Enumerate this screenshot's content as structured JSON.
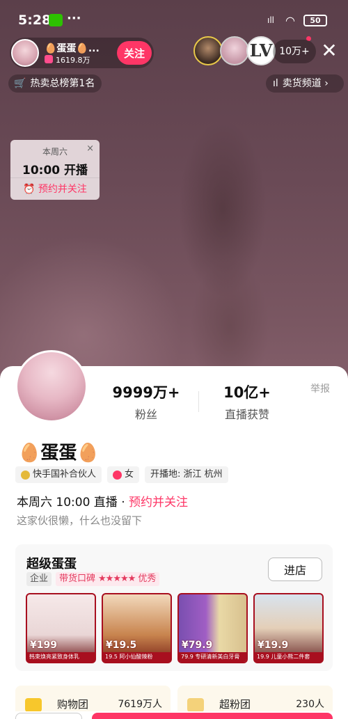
{
  "status_bar": {
    "time": "5:28",
    "dots": "···",
    "signal": "ıll",
    "battery": "50"
  },
  "streamer": {
    "name": "🥚蛋蛋🥚...",
    "likes": "1619.8万",
    "follow_label": "关注"
  },
  "viewers": {
    "count": "10万+",
    "v3_logo": "LV"
  },
  "close_glyph": "✕",
  "rank": {
    "icon": "🛒",
    "label": "热卖总榜第1名"
  },
  "channel": {
    "label": "卖货频道 ›"
  },
  "schedule_popup": {
    "day": "本周六",
    "time": "10:00 开播",
    "remind_label": "⏰ 预约并关注",
    "close": "×"
  },
  "profile": {
    "fans_value": "9999万+",
    "fans_label": "粉丝",
    "likes_value": "10亿+",
    "likes_label": "直播获赞",
    "report": "举报",
    "name": "🥚蛋蛋🥚",
    "tags": [
      "快手国补合伙人",
      "女",
      "开播地: 浙江 杭州"
    ],
    "schedule_text": "本周六 10:00 直播 · ",
    "schedule_link": "预约并关注",
    "bio": "这家伙很懒，什么也没留下"
  },
  "shop": {
    "name": "超级蛋蛋",
    "badge_enterprise": "企业",
    "badge_rating_label": "带货口碑",
    "badge_stars": "★★★★★",
    "badge_rating_value": "优秀",
    "enter_label": "进店",
    "products": [
      {
        "price": "¥199",
        "caption": "韩束焕亮紧致身体乳"
      },
      {
        "price": "¥19.5",
        "caption": "19.5 阿小仙酸辣粉"
      },
      {
        "price": "¥79.9",
        "caption": "79.9 专研清新美白牙膏"
      },
      {
        "price": "¥19.9",
        "caption": "19.9 儿童小熊二件套"
      }
    ]
  },
  "groups": [
    {
      "name": "购物团",
      "count": "7619万人"
    },
    {
      "name": "超粉团",
      "count": "230人"
    }
  ]
}
